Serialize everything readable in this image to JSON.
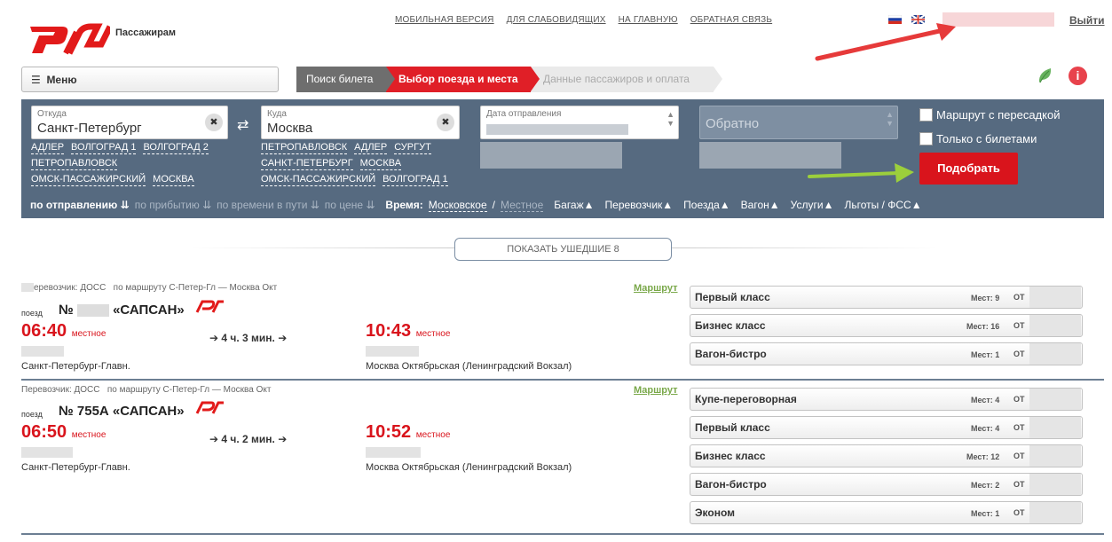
{
  "header": {
    "logo_text": "Пассажирам",
    "links": [
      "МОБИЛЬНАЯ ВЕРСИЯ",
      "ДЛЯ СЛАБОВИДЯЩИХ",
      "НА ГЛАВНУЮ",
      "ОБРАТНАЯ СВЯЗЬ"
    ],
    "logout": "Выйти"
  },
  "menu": {
    "label": "Меню",
    "icon": "hamburger-icon"
  },
  "steps": [
    {
      "label": "Поиск билета",
      "state": "done",
      "color": "#6e6e6e"
    },
    {
      "label": "Выбор поезда и места",
      "state": "active",
      "color": "#e01f27"
    },
    {
      "label": "Данные пассажиров и оплата",
      "state": "pending",
      "color": "#eaeaea"
    }
  ],
  "search": {
    "from": {
      "label": "Откуда",
      "value": "Санкт-Петербург",
      "suggestions": [
        "АДЛЕР",
        "ВОЛГОГРАД 1",
        "ВОЛГОГРАД 2",
        "ПЕТРОПАВЛОВСК",
        "ОМСК-ПАССАЖИРСКИЙ",
        "МОСКВА"
      ]
    },
    "to": {
      "label": "Куда",
      "value": "Москва",
      "suggestions": [
        "ПЕТРОПАВЛОВСК",
        "АДЛЕР",
        "СУРГУТ",
        "САНКТ-ПЕТЕРБУРГ",
        "МОСКВА",
        "ОМСК-ПАССАЖИРСКИЙ",
        "ВОЛГОГРАД 1"
      ]
    },
    "date": {
      "label": "Дата отправления"
    },
    "back": {
      "placeholder": "Обратно"
    },
    "with_transfer": "Маршрут с пересадкой",
    "only_with_tickets": "Только с билетами",
    "submit": "Подобрать"
  },
  "sortbar": {
    "by_departure": "по отправлению",
    "by_arrival": "по прибытию",
    "by_travel_time": "по времени в пути",
    "by_price": "по цене",
    "time_label": "Время:",
    "time_moscow": "Московское",
    "time_separator": "/",
    "time_local": "Местное",
    "filters": [
      "Багаж",
      "Перевозчик",
      "Поезда",
      "Вагон",
      "Услуги",
      "Льготы / ФСС"
    ]
  },
  "show_gone": "ПОКАЗАТЬ УШЕДШИЕ 8",
  "trains": [
    {
      "carrier": "еревозчик: ДОСС",
      "route": "по маршруту С-Петер-Гл — Москва Окт",
      "route_link": "Маршрут",
      "poezd_label": "поезд",
      "number_prefix": "№",
      "name": "«САПСАН»",
      "dep_time": "06:40",
      "dep_note": "местное",
      "duration": "4 ч. 3 мин.",
      "arr_time": "10:43",
      "arr_note": "местное",
      "dep_station": "Санкт-Петербург-Главн.",
      "arr_station": "Москва Октябрьская (Ленинградский Вокзал)",
      "classes": [
        {
          "name": "Первый класс",
          "seats": "Мест: 9",
          "ot": "ОТ"
        },
        {
          "name": "Бизнес класс",
          "seats": "Мест: 16",
          "ot": "ОТ"
        },
        {
          "name": "Вагон-бистро",
          "seats": "Мест: 1",
          "ot": "ОТ"
        }
      ]
    },
    {
      "carrier": "Перевозчик: ДОСС",
      "route": "по маршруту С-Петер-Гл — Москва Окт",
      "route_link": "Маршрут",
      "poezd_label": "поезд",
      "number_prefix": "№ 755А",
      "name": "«САПСАН»",
      "dep_time": "06:50",
      "dep_note": "местное",
      "duration": "4 ч. 2 мин.",
      "arr_time": "10:52",
      "arr_note": "местное",
      "dep_station": "Санкт-Петербург-Главн.",
      "arr_station": "Москва Октябрьская (Ленинградский Вокзал)",
      "classes": [
        {
          "name": "Купе-переговорная",
          "seats": "Мест: 4",
          "ot": "ОТ"
        },
        {
          "name": "Первый класс",
          "seats": "Мест: 4",
          "ot": "ОТ"
        },
        {
          "name": "Бизнес класс",
          "seats": "Мест: 12",
          "ot": "ОТ"
        },
        {
          "name": "Вагон-бистро",
          "seats": "Мест: 2",
          "ot": "ОТ"
        },
        {
          "name": "Эконом",
          "seats": "Мест: 1",
          "ot": "ОТ"
        }
      ]
    }
  ]
}
